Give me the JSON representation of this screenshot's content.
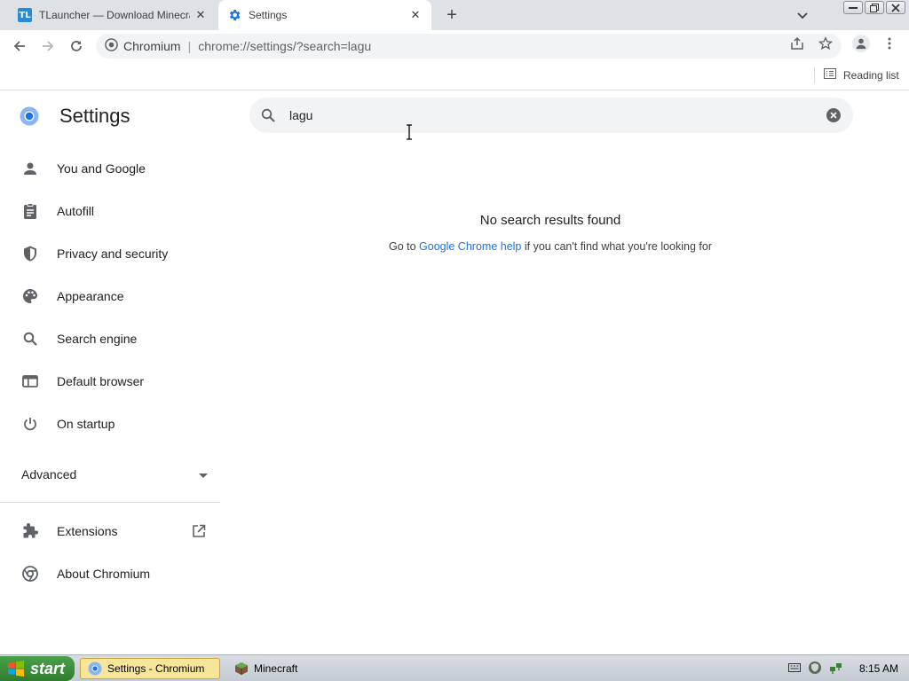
{
  "browser": {
    "tabs": [
      {
        "title": "TLauncher — Download Minecraft L",
        "favicon_text": "TL",
        "active": false
      },
      {
        "title": "Settings",
        "active": true
      }
    ],
    "omnibox": {
      "origin": "Chromium",
      "url": "chrome://settings/?search=lagu"
    },
    "bookmarks": {
      "reading_list": "Reading list"
    }
  },
  "settings": {
    "title": "Settings",
    "nav": [
      {
        "label": "You and Google",
        "icon": "person-icon"
      },
      {
        "label": "Autofill",
        "icon": "clipboard-icon"
      },
      {
        "label": "Privacy and security",
        "icon": "shield-icon"
      },
      {
        "label": "Appearance",
        "icon": "palette-icon"
      },
      {
        "label": "Search engine",
        "icon": "search-icon"
      },
      {
        "label": "Default browser",
        "icon": "browser-window-icon"
      },
      {
        "label": "On startup",
        "icon": "power-icon"
      }
    ],
    "advanced": "Advanced",
    "extensions": "Extensions",
    "about": "About Chromium",
    "search_value": "lagu",
    "no_results": "No search results found",
    "help_prefix": "Go to ",
    "help_link": "Google Chrome help",
    "help_suffix": " if you can't find what you're looking for"
  },
  "taskbar": {
    "start": "start",
    "tasks": [
      {
        "label": "Settings - Chromium",
        "active": true
      },
      {
        "label": "Minecraft",
        "active": false
      }
    ],
    "clock": "8:15 AM"
  },
  "colors": {
    "accent": "#1a73e8",
    "chrome_frame": "#dee1e6",
    "taskbar_active": "#f7e59a",
    "start_green": "#3a8f3a"
  }
}
